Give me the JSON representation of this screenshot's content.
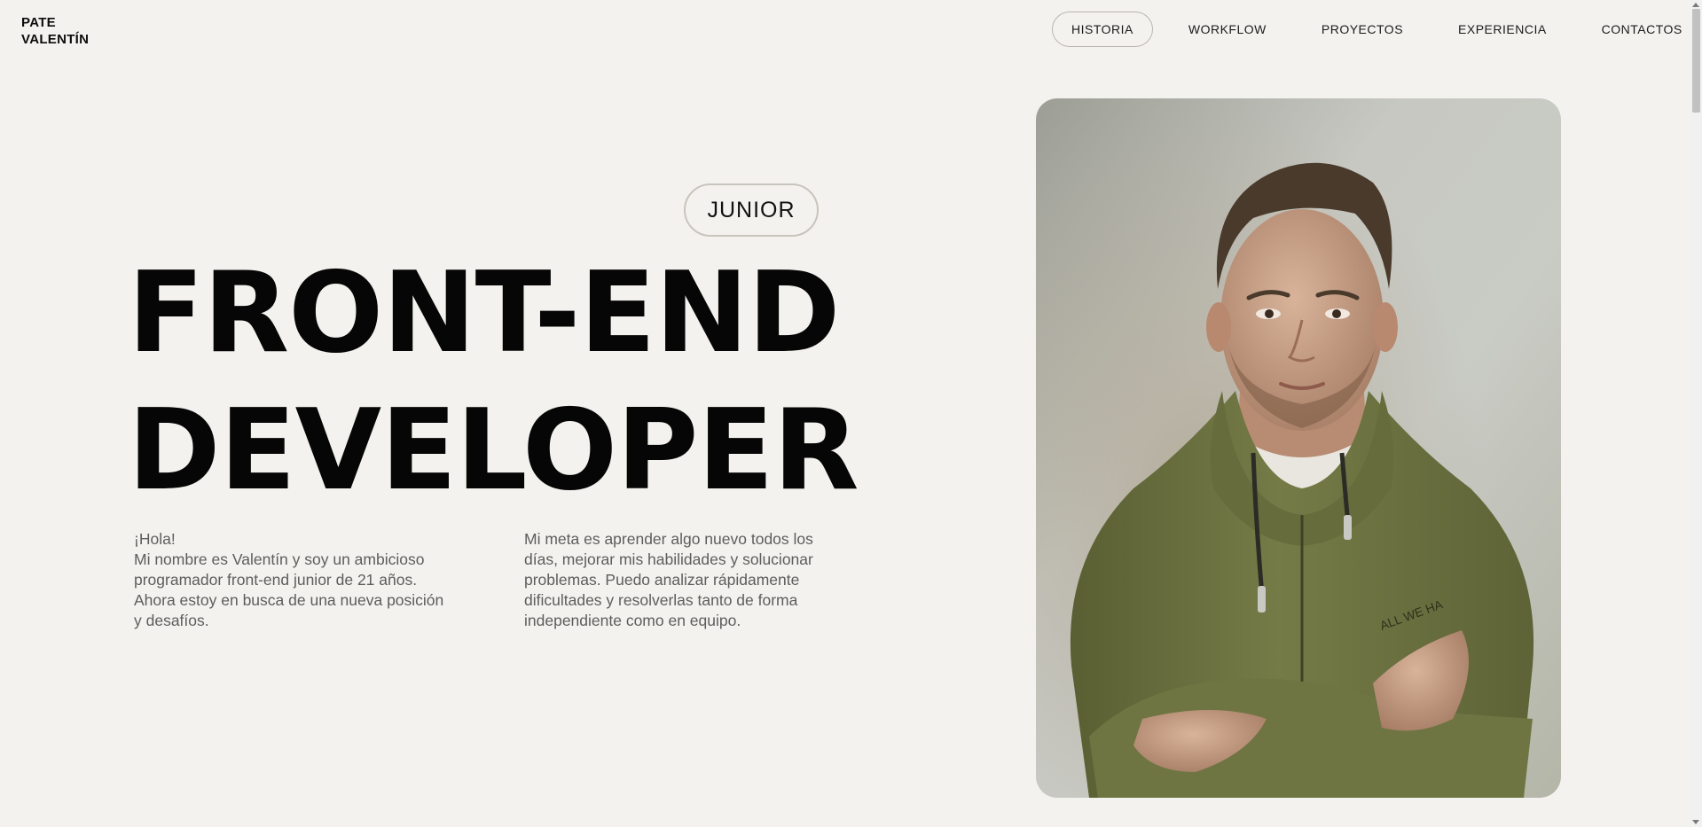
{
  "logo": {
    "line1": "PATE",
    "line2": "VALENTÍN"
  },
  "nav": {
    "items": [
      {
        "label": "HISTORIA",
        "active": true
      },
      {
        "label": "WORKFLOW"
      },
      {
        "label": "PROYECTOS"
      },
      {
        "label": "EXPERIENCIA"
      },
      {
        "label": "CONTACTOS"
      }
    ]
  },
  "hero": {
    "badge": "JUNIOR",
    "title_line1": "FRONT-END",
    "title_line2": "DEVELOPER",
    "intro_left_line1": "¡Hola!",
    "intro_left_line2": "Mi nombre es Valentín y soy un ambicioso programador front-end junior de 21 años. Ahora estoy en busca de una nueva posición y desafíos.",
    "intro_right": "Mi meta es aprender algo nuevo todos los días, mejorar mis habilidades y solucionar problemas. Puedo analizar rápidamente dificultades y resolverlas tanto de forma independiente como en equipo."
  },
  "photo": {
    "icon": "portrait-photo",
    "colors": {
      "wall": "#c9ccc6",
      "hoodie": "#6c7342",
      "skin": "#c9a389"
    }
  },
  "colors": {
    "background": "#f4f2ee",
    "text": "#0d0d0d",
    "muted": "#5d5d5d"
  }
}
